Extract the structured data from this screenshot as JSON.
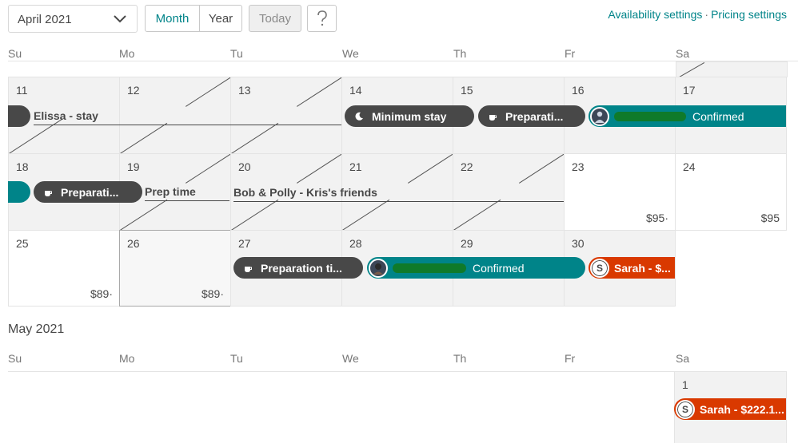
{
  "toolbar": {
    "month_select": "April 2021",
    "month_tab": "Month",
    "year_tab": "Year",
    "today": "Today",
    "help": "?",
    "availability_link": "Availability settings",
    "separator": "·",
    "pricing_link": "Pricing settings"
  },
  "weekdays": [
    "Su",
    "Mo",
    "Tu",
    "We",
    "Th",
    "Fr",
    "Sa"
  ],
  "april": {
    "days": [
      "11",
      "12",
      "13",
      "14",
      "15",
      "16",
      "17",
      "18",
      "19",
      "20",
      "21",
      "22",
      "23",
      "24",
      "25",
      "26",
      "27",
      "28",
      "29",
      "30"
    ],
    "prices": {
      "d23": "$95·",
      "d24": "$95",
      "d25": "$89·",
      "d26": "$89·"
    },
    "events": {
      "elissa": "Elissa - stay",
      "minimum_stay": "Minimum stay",
      "prep_w2": "Preparati...",
      "confirmed_w2": "Confirmed",
      "prep_w3": "Preparati...",
      "prep_time": "Prep time",
      "bob_polly": "Bob & Polly - Kris's friends",
      "prep_w4": "Preparation ti...",
      "confirmed_w4": "Confirmed",
      "sarah_w4": "Sarah - $...",
      "sarah_initial": "S"
    }
  },
  "may": {
    "title": "May 2021",
    "day1": "1",
    "sarah": "Sarah - $222.1...",
    "sarah_initial": "S"
  },
  "colors": {
    "teal": "#008489",
    "dark": "#484848",
    "orange": "#d93900",
    "blocked": "#f2f2f2"
  }
}
